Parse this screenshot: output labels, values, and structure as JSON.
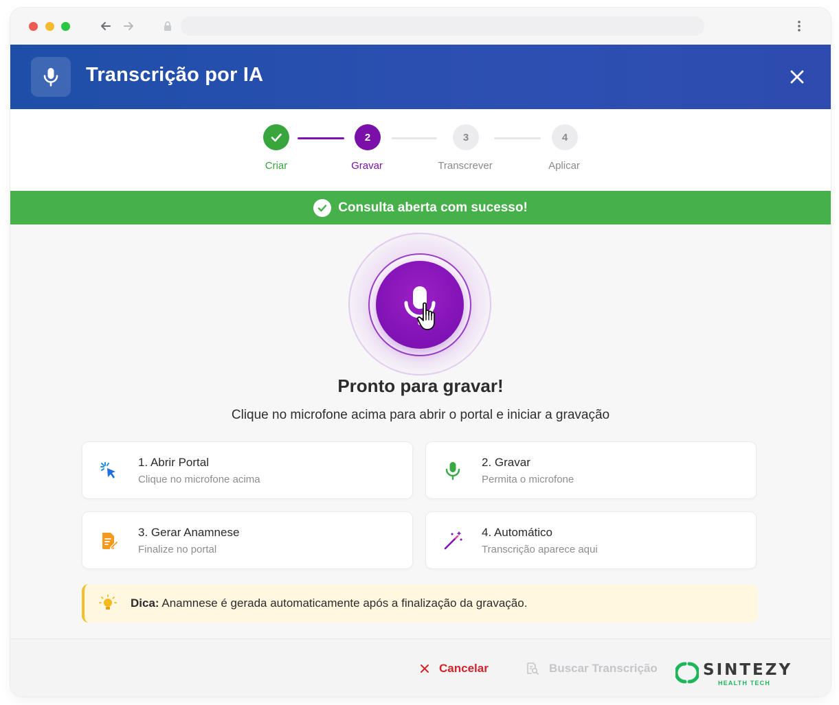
{
  "header": {
    "title": "Transcrição por IA"
  },
  "stepper": {
    "steps": [
      {
        "number": "1",
        "label": "Criar",
        "state": "done"
      },
      {
        "number": "2",
        "label": "Gravar",
        "state": "active"
      },
      {
        "number": "3",
        "label": "Transcrever",
        "state": "pending"
      },
      {
        "number": "4",
        "label": "Aplicar",
        "state": "pending"
      }
    ]
  },
  "banner": {
    "text": "Consulta aberta com sucesso!"
  },
  "main": {
    "title": "Pronto para gravar!",
    "subtitle": "Clique no microfone acima para abrir o portal e iniciar a gravação"
  },
  "cards": [
    {
      "title": "1. Abrir Portal",
      "desc": "Clique no microfone acima",
      "icon": "cursor-click-icon"
    },
    {
      "title": "2. Gravar",
      "desc": "Permita o microfone",
      "icon": "microphone-icon"
    },
    {
      "title": "3. Gerar Anamnese",
      "desc": "Finalize no portal",
      "icon": "document-edit-icon"
    },
    {
      "title": "4. Automático",
      "desc": "Transcrição aparece aqui",
      "icon": "magic-wand-icon"
    }
  ],
  "tip": {
    "label": "Dica:",
    "text": "Anamnese é gerada automaticamente após a finalização da gravação."
  },
  "footer": {
    "cancel_label": "Cancelar",
    "search_label": "Buscar Transcrição",
    "logo_name": "SINTEZY",
    "logo_sub": "HEALTH TECH"
  },
  "colors": {
    "header": "#2d4fb2",
    "success": "#46b04a",
    "accent": "#7f12b5",
    "cancel": "#d2232a",
    "tip_bg": "#fff7df"
  }
}
